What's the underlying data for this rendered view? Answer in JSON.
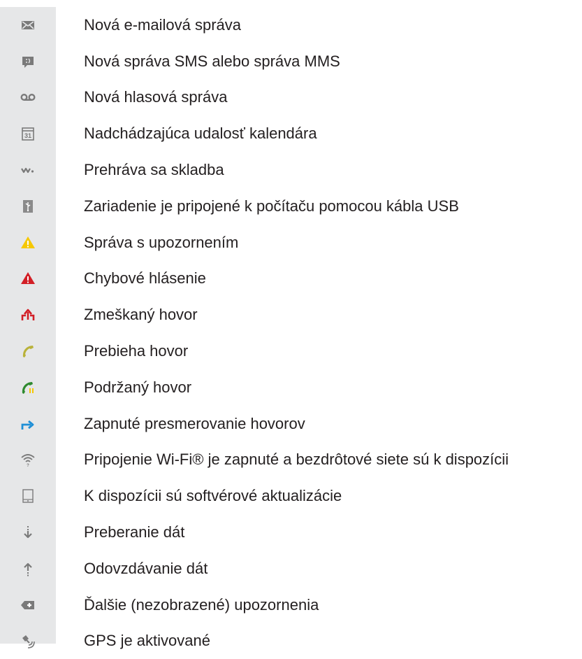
{
  "notifications": [
    {
      "icon": "email-icon",
      "label": "Nová e-mailová správa"
    },
    {
      "icon": "sms-mms-icon",
      "label": "Nová správa SMS alebo správa MMS"
    },
    {
      "icon": "voicemail-icon",
      "label": "Nová hlasová správa"
    },
    {
      "icon": "calendar-icon",
      "label": "Nadchádzajúca udalosť kalendára"
    },
    {
      "icon": "walkman-icon",
      "label": "Prehráva sa skladba"
    },
    {
      "icon": "usb-icon",
      "label": "Zariadenie je pripojené k počítaču pomocou kábla USB"
    },
    {
      "icon": "warning-icon",
      "label": "Správa s upozornením"
    },
    {
      "icon": "error-icon",
      "label": "Chybové hlásenie"
    },
    {
      "icon": "missed-call-icon",
      "label": "Zmeškaný hovor"
    },
    {
      "icon": "call-in-progress-icon",
      "label": "Prebieha hovor"
    },
    {
      "icon": "call-on-hold-icon",
      "label": "Podržaný hovor"
    },
    {
      "icon": "call-forwarding-icon",
      "label": "Zapnuté presmerovanie hovorov"
    },
    {
      "icon": "wifi-icon",
      "label": "Pripojenie Wi-Fi® je zapnuté a bezdrôtové siete sú k dispozícii"
    },
    {
      "icon": "software-update-icon",
      "label": "K dispozícii sú softvérové aktualizácie"
    },
    {
      "icon": "download-icon",
      "label": "Preberanie dát"
    },
    {
      "icon": "upload-icon",
      "label": "Odovzdávanie dát"
    },
    {
      "icon": "more-notifications-icon",
      "label": "Ďalšie (nezobrazené) upozornenia"
    },
    {
      "icon": "gps-icon",
      "label": "GPS je aktivované"
    }
  ],
  "colors": {
    "icon_column_bg": "#e6e7e8",
    "text": "#231f20",
    "icon_gray": "#7a7a7a",
    "warning_yellow": "#f6c800",
    "error_red": "#d21f26",
    "call_olive": "#b9b23a",
    "hold_green": "#2f8a2f",
    "forward_blue": "#1f8fd6"
  }
}
